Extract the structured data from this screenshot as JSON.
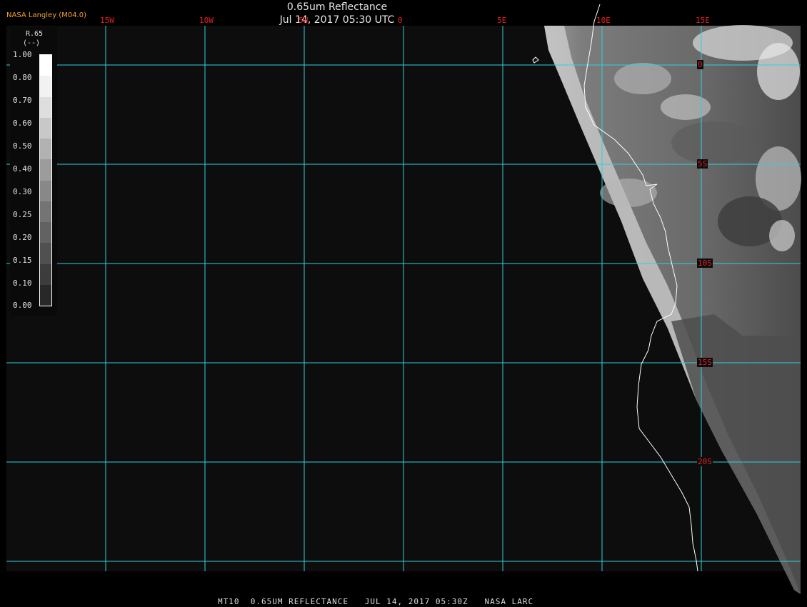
{
  "header": {
    "title": "0.65um Reflectance",
    "subtitle": "Jul 14, 2017 05:30 UTC",
    "credit": "NASA Langley (M04.0)"
  },
  "footer": "MT10  0.65UM REFLECTANCE   JUL 14, 2017 05:30Z   NASA LARC",
  "colorbar": {
    "title": "R.65",
    "unit": "(--)",
    "ticks": [
      "1.00",
      "0.80",
      "0.70",
      "0.60",
      "0.50",
      "0.40",
      "0.30",
      "0.25",
      "0.20",
      "0.15",
      "0.10",
      "0.00"
    ],
    "swatches": [
      "#ffffff",
      "#f2f2f2",
      "#dedede",
      "#c8c8c8",
      "#b2b2b2",
      "#9c9c9c",
      "#888888",
      "#747474",
      "#626262",
      "#505050",
      "#3c3c3c",
      "#282828"
    ]
  },
  "longitude_labels": [
    "15W",
    "10W",
    "5W",
    "0",
    "5E",
    "10E",
    "15E"
  ],
  "latitude_labels": [
    "0",
    "5S",
    "10S",
    "15S",
    "20S"
  ],
  "colors": {
    "background": "#0d0d0d",
    "grid": "#2fd0dc",
    "coast": "#ffffff",
    "axis_label": "#e02020",
    "credit": "#f0a030"
  }
}
